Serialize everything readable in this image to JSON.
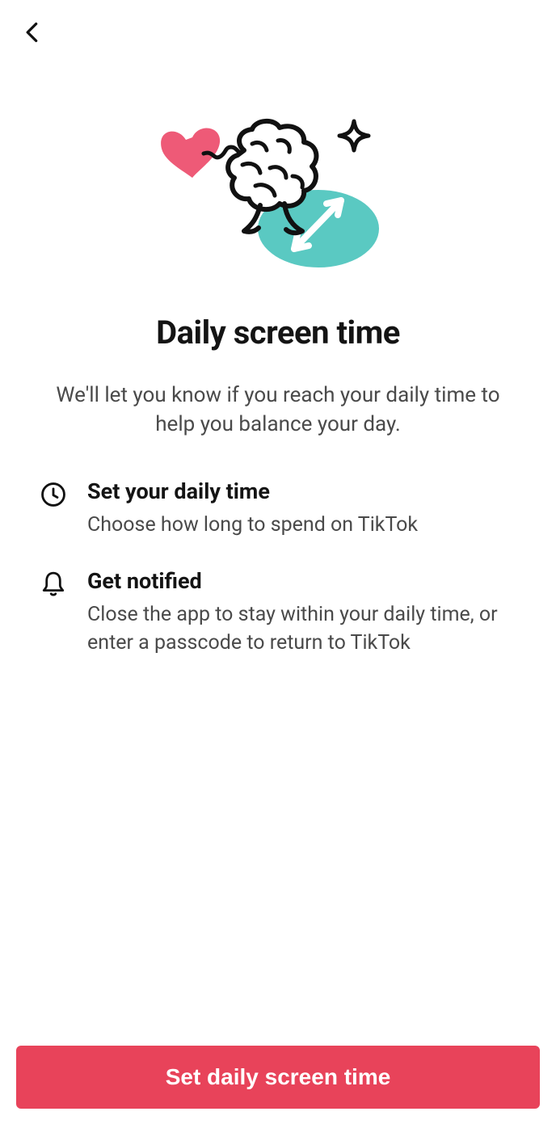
{
  "page": {
    "title": "Daily screen time",
    "subtitle": "We'll let you know if you reach your daily time to help you balance your day."
  },
  "features": [
    {
      "icon": "clock-icon",
      "title": "Set your daily time",
      "desc": "Choose how long to spend on TikTok"
    },
    {
      "icon": "bell-icon",
      "title": "Get notified",
      "desc": "Close the app to stay within your daily time, or enter a passcode to return to TikTok"
    }
  ],
  "cta": {
    "label": "Set daily screen time"
  }
}
